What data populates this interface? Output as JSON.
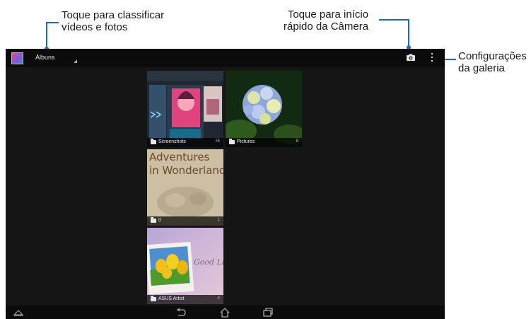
{
  "callouts": {
    "sort": "Toque para classificar\nvídeos e fotos",
    "camera": "Toque para início\nrápido da Câmera",
    "settings": "Configurações\nda galeria"
  },
  "actionbar": {
    "title": "Álbuns"
  },
  "albums": [
    {
      "name": "Screenshots",
      "count": "25"
    },
    {
      "name": "Pictures",
      "count": "8"
    },
    {
      "name": "0",
      "count": "1",
      "cover_text": "Adventures\nin Wonderland"
    },
    {
      "name": "ASUS Artist",
      "count": "4",
      "cover_text": "Good Lo"
    }
  ],
  "colors": {
    "callout_line": "#1b6fb3",
    "screen_bg": "#151515",
    "bar_bg": "#0b0b0b"
  },
  "icons": {
    "camera": "camera-icon",
    "menu": "overflow-menu-icon",
    "back": "back-icon",
    "home": "home-icon",
    "recents": "recent-apps-icon"
  }
}
